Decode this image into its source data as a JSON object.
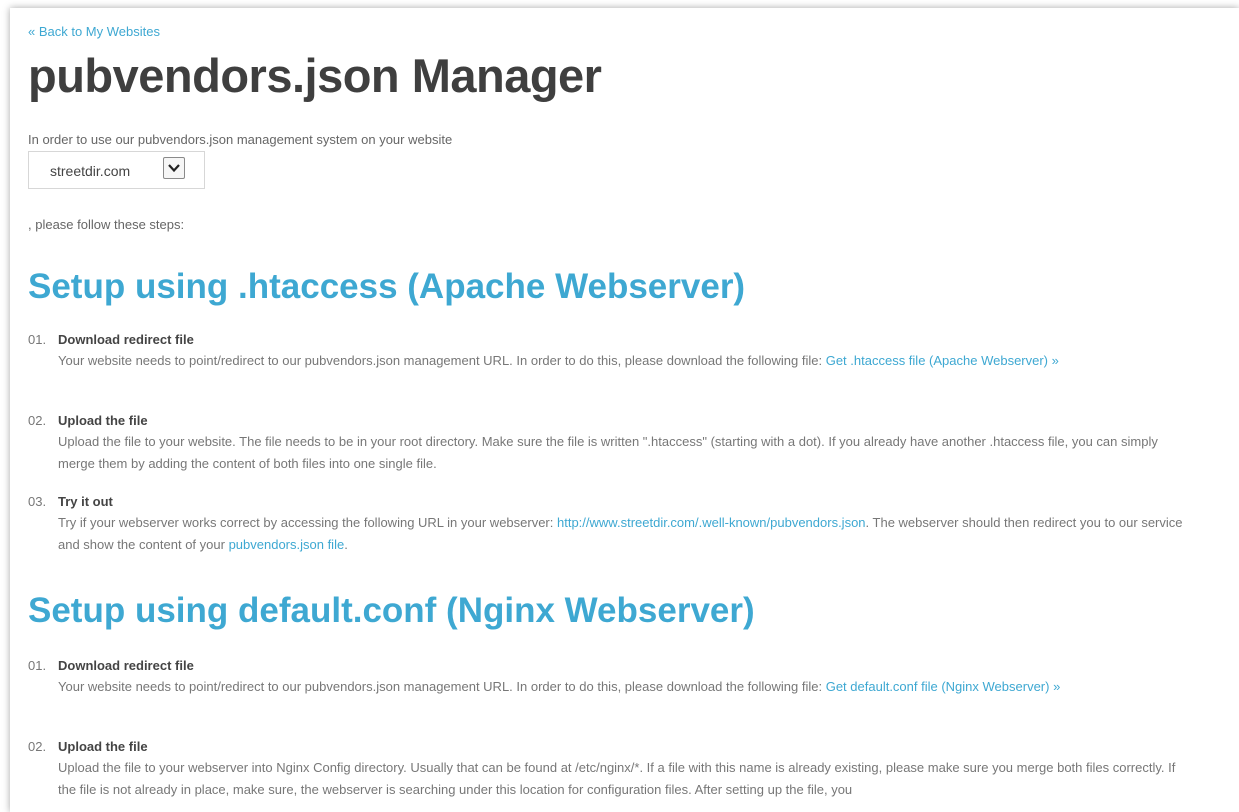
{
  "header": {
    "back_link": "« Back to My Websites",
    "title": "pubvendors.json Manager"
  },
  "intro": {
    "text": "In order to use our pubvendors.json management system on your website",
    "selected_site": "streetdir.com",
    "after_text": ", please follow these steps:"
  },
  "sections": [
    {
      "heading": "Setup using .htaccess (Apache Webserver)",
      "steps": [
        {
          "number": "01.",
          "title": "Download redirect file",
          "text": "Your website needs to point/redirect to our pubvendors.json management URL. In order to do this, please download the following file: ",
          "link": "Get .htaccess file (Apache Webserver) »"
        },
        {
          "number": "02.",
          "title": "Upload the file",
          "text": "Upload the file to your website. The file needs to be in your root directory. Make sure the file is written \".htaccess\" (starting with a dot). If you already have another .htaccess file, you can simply merge them by adding the content of both files into one single file."
        },
        {
          "number": "03.",
          "title": "Try it out",
          "text_before": "Try if your webserver works correct by accessing the following URL in your webserver: ",
          "url": "http://www.streetdir.com/.well-known/pubvendors.json",
          "text_middle": ". The webserver should then redirect you to our service and show the content of your ",
          "link": "pubvendors.json file",
          "text_after": "."
        }
      ]
    },
    {
      "heading": "Setup using default.conf (Nginx Webserver)",
      "steps": [
        {
          "number": "01.",
          "title": "Download redirect file",
          "text": "Your website needs to point/redirect to our pubvendors.json management URL. In order to do this, please download the following file: ",
          "link": "Get default.conf file (Nginx Webserver) »"
        },
        {
          "number": "02.",
          "title": "Upload the file",
          "text": "Upload the file to your webserver into Nginx Config directory. Usually that can be found at /etc/nginx/*. If a file with this name is already existing, please make sure you merge both files correctly. If the file is not already in place, make sure, the webserver is searching under this location for configuration files. After setting up the file, you"
        }
      ]
    }
  ],
  "colors": {
    "accent": "#3ea8d2",
    "title": "#3f3f3f",
    "body_text": "#777777"
  }
}
